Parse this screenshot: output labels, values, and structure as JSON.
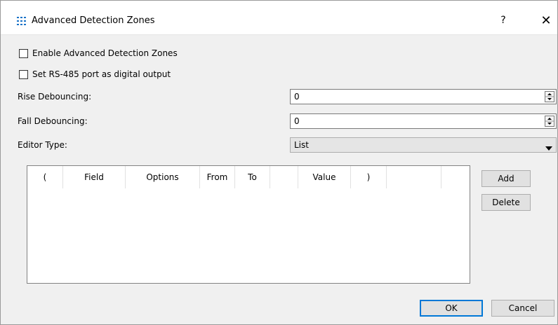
{
  "window": {
    "title": "Advanced Detection Zones",
    "help_glyph": "?",
    "close_glyph": "✕"
  },
  "options": {
    "enable_zones_label": "Enable Advanced Detection Zones",
    "enable_zones_checked": false,
    "rs485_label": "Set RS-485 port as digital output",
    "rs485_checked": false
  },
  "fields": {
    "rise_label": "Rise Debouncing:",
    "rise_value": "0",
    "fall_label": "Fall Debouncing:",
    "fall_value": "0",
    "editor_type_label": "Editor Type:",
    "editor_type_value": "List"
  },
  "table": {
    "columns": [
      "(",
      "Field",
      "Options",
      "From",
      "To",
      "",
      "Value",
      ")",
      "",
      ""
    ],
    "rows": []
  },
  "buttons": {
    "add": "Add",
    "delete": "Delete",
    "ok": "OK",
    "cancel": "Cancel"
  },
  "colors": {
    "dialog_bg": "#f0f0f0",
    "title_bg": "#ffffff",
    "default_button_border": "#0078d7",
    "icon": "#1a73c8"
  },
  "icons": {
    "app": "grid-icon",
    "spin": "spin-arrows-icon",
    "dropdown": "triangle-down-icon"
  }
}
